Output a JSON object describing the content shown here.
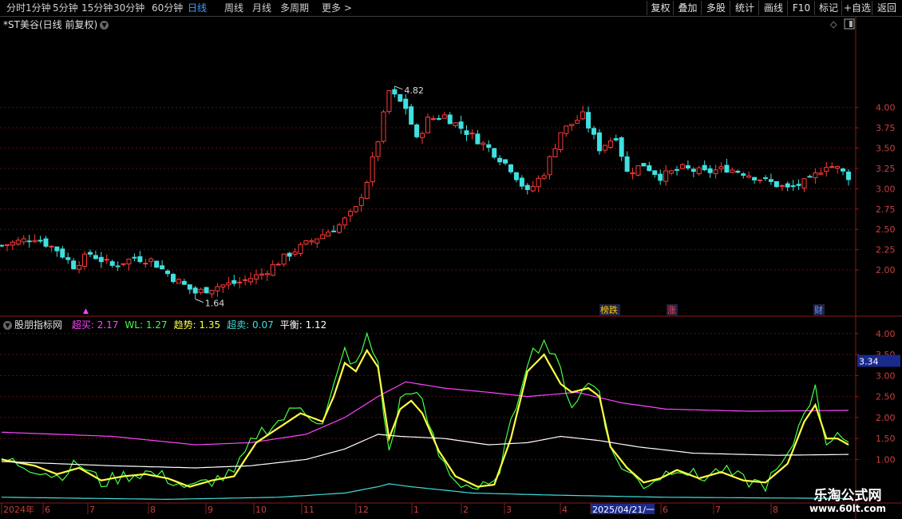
{
  "toolbar": {
    "tabs": [
      "分时",
      "1分钟",
      "5分钟",
      "15分钟",
      "30分钟",
      "60分钟",
      "日线",
      "周线",
      "月线",
      "多周期",
      "更多"
    ],
    "active_tab": "日线",
    "right_buttons": [
      "复权",
      "叠加",
      "多股",
      "统计",
      "画线",
      "F10",
      "标记",
      "+自选",
      "返回"
    ]
  },
  "stock": {
    "title": "*ST美谷(日线 前复权)"
  },
  "indicator": {
    "name": "股朋指标网",
    "items": [
      {
        "label": "超买:",
        "value": "2.17",
        "color": "#ff44ff"
      },
      {
        "label": "WL:",
        "value": "1.27",
        "color": "#44ff44"
      },
      {
        "label": "趋势:",
        "value": "1.35",
        "color": "#ffff44"
      },
      {
        "label": "超卖:",
        "value": "0.07",
        "color": "#44dddd"
      },
      {
        "label": "平衡:",
        "value": "1.12",
        "color": "#ffffff"
      }
    ],
    "current_value_box": "3.34"
  },
  "price_markers": {
    "high": "4.82",
    "low": "1.64"
  },
  "event_labels": [
    {
      "text": "榜跌",
      "color": "#ffcc00"
    },
    {
      "text": "涨",
      "color": "#ff4444"
    },
    {
      "text": "财",
      "color": "#6699ff"
    }
  ],
  "x_axis": {
    "labels": [
      "2024年",
      "6",
      "7",
      "8",
      "9",
      "10",
      "11",
      "12",
      "1",
      "2",
      "3",
      "4",
      "2025/04/21/一",
      "6",
      "7",
      "8"
    ],
    "highlighted": "2025/04/21/一"
  },
  "watermark": {
    "line1": "乐淘公式网",
    "line2": "www.60lt.com"
  },
  "chart_data": [
    {
      "type": "candlestick",
      "y_ticks": [
        "4.00",
        "3.75",
        "3.50",
        "3.25",
        "3.00",
        "2.75",
        "2.50",
        "2.25",
        "2.00"
      ],
      "ylim": [
        1.45,
        4.95
      ],
      "anchors_close": [
        [
          0,
          2.3
        ],
        [
          6,
          2.4
        ],
        [
          10,
          2.25
        ],
        [
          13,
          2.05
        ],
        [
          16,
          2.2
        ],
        [
          20,
          2.05
        ],
        [
          24,
          2.15
        ],
        [
          27,
          2.12
        ],
        [
          31,
          1.9
        ],
        [
          35,
          1.72
        ],
        [
          39,
          1.8
        ],
        [
          43,
          1.85
        ],
        [
          47,
          1.95
        ],
        [
          52,
          2.2
        ],
        [
          57,
          2.4
        ],
        [
          61,
          2.55
        ],
        [
          64,
          2.75
        ],
        [
          66,
          3.1
        ],
        [
          68,
          3.6
        ],
        [
          70,
          4.2
        ],
        [
          73,
          4.0
        ],
        [
          75,
          3.6
        ],
        [
          77,
          3.85
        ],
        [
          80,
          3.9
        ],
        [
          84,
          3.7
        ],
        [
          88,
          3.5
        ],
        [
          92,
          3.25
        ],
        [
          95,
          2.95
        ],
        [
          98,
          3.2
        ],
        [
          101,
          3.7
        ],
        [
          105,
          3.9
        ],
        [
          108,
          3.5
        ],
        [
          111,
          3.65
        ],
        [
          113,
          3.2
        ],
        [
          116,
          3.3
        ],
        [
          119,
          3.15
        ],
        [
          123,
          3.25
        ],
        [
          127,
          3.2
        ],
        [
          131,
          3.25
        ],
        [
          134,
          3.2
        ],
        [
          138,
          3.1
        ],
        [
          142,
          3.0
        ],
        [
          146,
          3.1
        ],
        [
          149,
          3.3
        ],
        [
          151,
          3.25
        ],
        [
          153,
          3.15
        ]
      ],
      "candle_count": 154
    },
    {
      "type": "line",
      "y_ticks": [
        "4.00",
        "3.50",
        "3.00",
        "2.50",
        "2.00",
        "1.50",
        "1.00"
      ],
      "ylim": [
        0.0,
        4.3
      ],
      "series": [
        {
          "name": "超买",
          "color": "#ff44ff",
          "anchors": [
            [
              0,
              1.65
            ],
            [
              20,
              1.55
            ],
            [
              35,
              1.35
            ],
            [
              45,
              1.4
            ],
            [
              55,
              1.6
            ],
            [
              62,
              2.0
            ],
            [
              68,
              2.5
            ],
            [
              73,
              2.85
            ],
            [
              80,
              2.7
            ],
            [
              88,
              2.6
            ],
            [
              95,
              2.5
            ],
            [
              104,
              2.6
            ],
            [
              112,
              2.35
            ],
            [
              120,
              2.2
            ],
            [
              135,
              2.15
            ],
            [
              153,
              2.17
            ]
          ]
        },
        {
          "name": "WL",
          "color": "#44ff44",
          "anchors": [
            [
              0,
              1.0
            ],
            [
              6,
              0.8
            ],
            [
              10,
              0.6
            ],
            [
              14,
              0.9
            ],
            [
              18,
              0.45
            ],
            [
              22,
              0.6
            ],
            [
              26,
              0.7
            ],
            [
              30,
              0.55
            ],
            [
              34,
              0.3
            ],
            [
              38,
              0.5
            ],
            [
              42,
              0.65
            ],
            [
              46,
              1.6
            ],
            [
              50,
              1.9
            ],
            [
              54,
              2.3
            ],
            [
              58,
              1.8
            ],
            [
              60,
              2.7
            ],
            [
              62,
              3.6
            ],
            [
              64,
              3.2
            ],
            [
              66,
              3.9
            ],
            [
              68,
              3.3
            ],
            [
              70,
              1.1
            ],
            [
              72,
              2.4
            ],
            [
              74,
              2.7
            ],
            [
              76,
              2.3
            ],
            [
              79,
              1.1
            ],
            [
              82,
              0.5
            ],
            [
              86,
              0.3
            ],
            [
              89,
              0.35
            ],
            [
              92,
              1.8
            ],
            [
              95,
              3.4
            ],
            [
              98,
              3.85
            ],
            [
              101,
              3.1
            ],
            [
              103,
              2.3
            ],
            [
              106,
              2.8
            ],
            [
              108,
              2.7
            ],
            [
              110,
              1.2
            ],
            [
              113,
              0.7
            ],
            [
              116,
              0.4
            ],
            [
              119,
              0.6
            ],
            [
              122,
              0.85
            ],
            [
              126,
              0.55
            ],
            [
              130,
              0.75
            ],
            [
              134,
              0.5
            ],
            [
              138,
              0.4
            ],
            [
              142,
              1.0
            ],
            [
              145,
              2.2
            ],
            [
              147,
              2.65
            ],
            [
              149,
              1.4
            ],
            [
              151,
              1.7
            ],
            [
              153,
              1.27
            ]
          ]
        },
        {
          "name": "趋势",
          "color": "#ffff44",
          "anchors": [
            [
              0,
              1.0
            ],
            [
              6,
              0.85
            ],
            [
              10,
              0.65
            ],
            [
              14,
              0.8
            ],
            [
              18,
              0.5
            ],
            [
              22,
              0.6
            ],
            [
              26,
              0.65
            ],
            [
              30,
              0.55
            ],
            [
              34,
              0.35
            ],
            [
              38,
              0.5
            ],
            [
              42,
              0.6
            ],
            [
              46,
              1.4
            ],
            [
              50,
              1.75
            ],
            [
              54,
              2.1
            ],
            [
              58,
              1.9
            ],
            [
              60,
              2.5
            ],
            [
              62,
              3.3
            ],
            [
              64,
              3.1
            ],
            [
              66,
              3.6
            ],
            [
              68,
              3.2
            ],
            [
              70,
              1.5
            ],
            [
              72,
              2.2
            ],
            [
              74,
              2.4
            ],
            [
              76,
              2.1
            ],
            [
              79,
              1.2
            ],
            [
              82,
              0.6
            ],
            [
              86,
              0.35
            ],
            [
              89,
              0.4
            ],
            [
              92,
              1.5
            ],
            [
              95,
              3.1
            ],
            [
              98,
              3.5
            ],
            [
              101,
              2.8
            ],
            [
              103,
              2.6
            ],
            [
              106,
              2.7
            ],
            [
              108,
              2.5
            ],
            [
              110,
              1.3
            ],
            [
              113,
              0.8
            ],
            [
              116,
              0.45
            ],
            [
              119,
              0.55
            ],
            [
              122,
              0.75
            ],
            [
              126,
              0.55
            ],
            [
              130,
              0.7
            ],
            [
              134,
              0.5
            ],
            [
              138,
              0.45
            ],
            [
              142,
              0.9
            ],
            [
              145,
              1.9
            ],
            [
              147,
              2.3
            ],
            [
              149,
              1.5
            ],
            [
              151,
              1.5
            ],
            [
              153,
              1.35
            ]
          ]
        },
        {
          "name": "超卖",
          "color": "#44dddd",
          "anchors": [
            [
              0,
              0.1
            ],
            [
              30,
              0.05
            ],
            [
              50,
              0.1
            ],
            [
              62,
              0.2
            ],
            [
              68,
              0.35
            ],
            [
              70,
              0.42
            ],
            [
              74,
              0.35
            ],
            [
              85,
              0.2
            ],
            [
              100,
              0.15
            ],
            [
              120,
              0.1
            ],
            [
              153,
              0.07
            ]
          ]
        },
        {
          "name": "平衡",
          "color": "#ffffff",
          "anchors": [
            [
              0,
              0.95
            ],
            [
              20,
              0.85
            ],
            [
              35,
              0.8
            ],
            [
              45,
              0.85
            ],
            [
              55,
              1.0
            ],
            [
              62,
              1.25
            ],
            [
              68,
              1.6
            ],
            [
              72,
              1.55
            ],
            [
              80,
              1.5
            ],
            [
              88,
              1.35
            ],
            [
              95,
              1.4
            ],
            [
              101,
              1.55
            ],
            [
              108,
              1.45
            ],
            [
              115,
              1.3
            ],
            [
              125,
              1.15
            ],
            [
              140,
              1.1
            ],
            [
              153,
              1.12
            ]
          ]
        }
      ]
    }
  ]
}
